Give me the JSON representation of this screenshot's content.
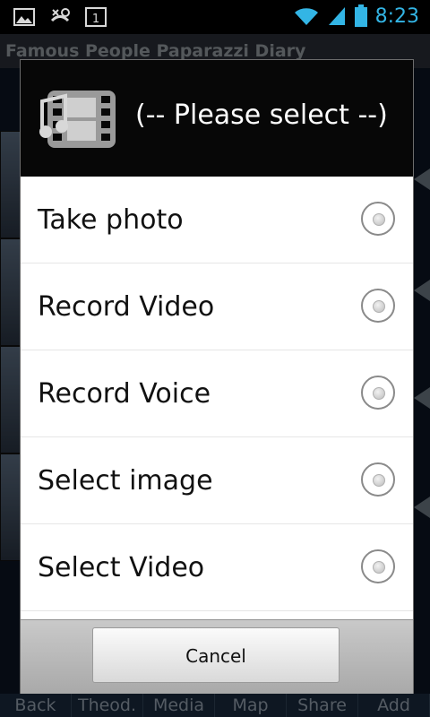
{
  "status_bar": {
    "time": "8:23",
    "icons_left": [
      "image-notification-icon",
      "missed-call-icon",
      "calendar-icon"
    ],
    "calendar_day": "1",
    "icons_right": [
      "wifi-icon",
      "signal-icon",
      "battery-icon"
    ]
  },
  "app": {
    "title": "Famous People Paparazzi Diary",
    "bottom_tabs": [
      "Back",
      "Theod.",
      "Media",
      "Map",
      "Share",
      "Add"
    ]
  },
  "dialog": {
    "title": "(-- Please select --)",
    "icon": "media-icon",
    "options": [
      {
        "label": "Take photo",
        "selected": false
      },
      {
        "label": "Record Video",
        "selected": false
      },
      {
        "label": "Record Voice",
        "selected": false
      },
      {
        "label": "Select image",
        "selected": false
      },
      {
        "label": "Select Video",
        "selected": false
      }
    ],
    "cancel_label": "Cancel"
  }
}
